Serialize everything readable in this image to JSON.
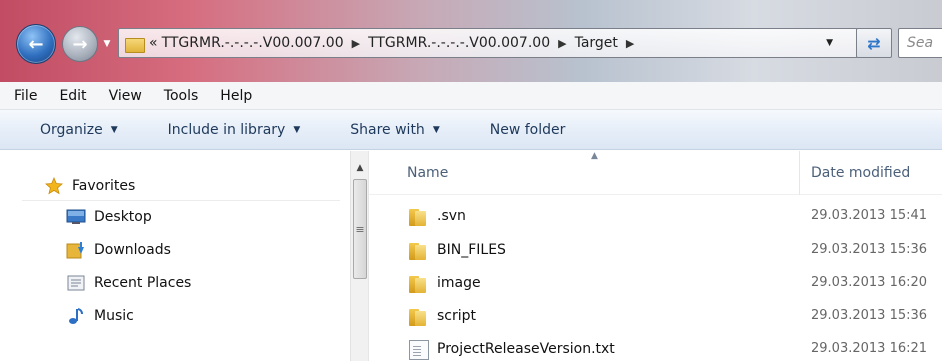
{
  "address": {
    "more": "«",
    "crumbs": [
      "TTGRMR.-.-.-.-.V00.007.00",
      "TTGRMR.-.-.-.-.V00.007.00",
      "Target"
    ],
    "search_placeholder": "Sea"
  },
  "menu": [
    "File",
    "Edit",
    "View",
    "Tools",
    "Help"
  ],
  "commands": {
    "organize": "Organize",
    "include_library": "Include in library",
    "share_with": "Share with",
    "new_folder": "New folder"
  },
  "nav": {
    "favorites": "Favorites",
    "items": [
      "Desktop",
      "Downloads",
      "Recent Places",
      "Music"
    ]
  },
  "columns": {
    "name": "Name",
    "date": "Date modified"
  },
  "files": [
    {
      "name": ".svn",
      "date": "29.03.2013 15:41",
      "type": "folder"
    },
    {
      "name": "BIN_FILES",
      "date": "29.03.2013 15:36",
      "type": "folder"
    },
    {
      "name": "image",
      "date": "29.03.2013 16:20",
      "type": "folder"
    },
    {
      "name": "script",
      "date": "29.03.2013 15:36",
      "type": "folder"
    },
    {
      "name": "ProjectReleaseVersion.txt",
      "date": "29.03.2013 16:21",
      "type": "text"
    }
  ]
}
